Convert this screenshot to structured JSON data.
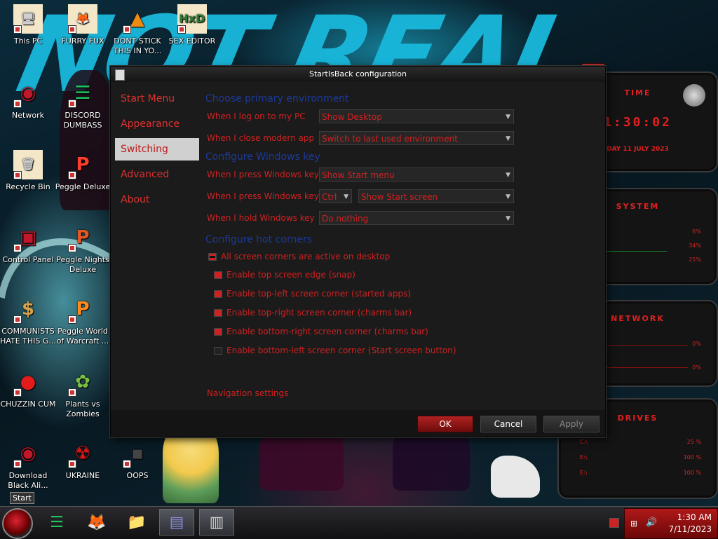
{
  "wallpaper": {
    "text": "NOT REAL"
  },
  "desktop_icons": [
    {
      "label": "This PC",
      "icon": "computer-icon",
      "glyph": "🖥",
      "color": "#d0d0d0"
    },
    {
      "label": "FURRY FUX",
      "icon": "firefox-icon",
      "glyph": "🦊",
      "color": "#f5721b"
    },
    {
      "label": "DONT STICK THIS IN YO...",
      "icon": "vlc-icon",
      "glyph": "▲",
      "color": "#f08a10"
    },
    {
      "label": "SEX EDITOR",
      "icon": "hxd-icon",
      "glyph": "HxD",
      "color": "#2e7d32"
    },
    {
      "label": "Network",
      "icon": "network-icon",
      "glyph": "◉",
      "color": "#c0182a"
    },
    {
      "label": "DISCORD DUMBASS",
      "icon": "chat-icon",
      "glyph": "☰",
      "color": "#1ec25e"
    },
    {
      "label": "Recycle Bin",
      "icon": "recycle-bin-icon",
      "glyph": "🗑",
      "color": "#cfcfcf"
    },
    {
      "label": "Peggle Deluxe",
      "icon": "peggle-icon",
      "glyph": "P",
      "color": "#ff3d2d"
    },
    {
      "label": "Control Panel",
      "icon": "control-panel-icon",
      "glyph": "▣",
      "color": "#c0182a"
    },
    {
      "label": "Peggle Nights Deluxe",
      "icon": "peggle-nights-icon",
      "glyph": "P",
      "color": "#e45722"
    },
    {
      "label": "COMMUNISTS HATE THIS G...",
      "icon": "money-bag-icon",
      "glyph": "$",
      "color": "#d6a24a"
    },
    {
      "label": "Peggle World of Warcraft ...",
      "icon": "peggle-wow-icon",
      "glyph": "P",
      "color": "#ff8a1a"
    },
    {
      "label": "CHUZZIN CUM",
      "icon": "chuzzle-icon",
      "glyph": "●",
      "color": "#e21b1b"
    },
    {
      "label": "Plants vs Zombies",
      "icon": "plants-icon",
      "glyph": "✿",
      "color": "#7bc043"
    },
    {
      "label": "Download Black Ali...",
      "icon": "alien-theme-icon",
      "glyph": "◉",
      "color": "#c0182a"
    },
    {
      "label": "UKRAINE",
      "icon": "radiation-icon",
      "glyph": "☢",
      "color": "#d81818"
    },
    {
      "label": "OOPS",
      "icon": "oops-icon",
      "glyph": "▪",
      "color": "#444"
    }
  ],
  "dialog": {
    "title": "StartIsBack configuration",
    "nav": [
      "Start Menu",
      "Appearance",
      "Switching",
      "Advanced",
      "About"
    ],
    "active_nav": "Switching",
    "sections": {
      "env": "Choose primary environment",
      "winkey": "Configure Windows key",
      "corners": "Configure hot corners"
    },
    "rows": {
      "logon_label": "When I log on to my PC",
      "logon_value": "Show Desktop",
      "close_label": "When I close modern app",
      "close_value": "Switch to last used environment",
      "press_label": "When I press Windows key",
      "press_value": "Show Start menu",
      "press_plus_label": "When I press Windows key +",
      "press_plus_mod": "Ctrl",
      "press_plus_value": "Show Start screen",
      "hold_label": "When I hold Windows key",
      "hold_value": "Do nothing"
    },
    "checkboxes": [
      {
        "label": "All screen corners are active on desktop",
        "state": "partial"
      },
      {
        "label": "Enable top screen edge (snap)",
        "state": "checked"
      },
      {
        "label": "Enable top-left screen corner (started apps)",
        "state": "checked"
      },
      {
        "label": "Enable top-right screen corner (charms bar)",
        "state": "checked"
      },
      {
        "label": "Enable bottom-right screen corner (charms bar)",
        "state": "checked"
      },
      {
        "label": "Enable bottom-left screen corner (Start screen button)",
        "state": "unchecked"
      }
    ],
    "nav_settings_link": "Navigation settings",
    "buttons": {
      "ok": "OK",
      "cancel": "Cancel",
      "apply": "Apply"
    }
  },
  "gadgets": {
    "time_title": "TIME",
    "time_value": "1:30:02",
    "date_value": "DAY 11 JULY 2023",
    "system_title": "SYSTEM",
    "system_values": [
      "6%",
      "34%",
      "25%"
    ],
    "network_title": "NETWORK",
    "network_values": [
      "0%",
      "0%"
    ],
    "drives_title": "DRIVES",
    "drive_rows": [
      {
        "name": "C:\\",
        "value": "25 %"
      },
      {
        "name": "E:\\",
        "value": "100 %"
      },
      {
        "name": "E:\\",
        "value": "100 %"
      }
    ]
  },
  "taskbar": {
    "start_tooltip": "Start",
    "apps": [
      {
        "name": "chat-app",
        "glyph": "☰",
        "color": "#1ec25e"
      },
      {
        "name": "firefox",
        "glyph": "🦊",
        "color": "#f5721b"
      },
      {
        "name": "file-explorer",
        "glyph": "📁",
        "color": "#f0c040"
      },
      {
        "name": "settings-window",
        "glyph": "▤",
        "color": "#8c8cd8"
      },
      {
        "name": "startisback-window",
        "glyph": "▥",
        "color": "#ccc"
      }
    ],
    "time": "1:30 AM",
    "date": "7/11/2023"
  },
  "colors": {
    "accent_red": "#d22020",
    "section_blue": "#1a3a9a"
  }
}
